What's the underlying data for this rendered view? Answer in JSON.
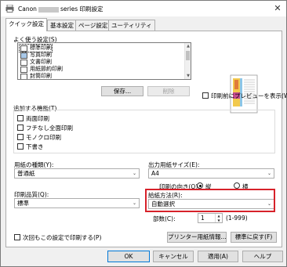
{
  "window": {
    "title_prefix": "Canon",
    "title_suffix": "series 印刷設定",
    "close_glyph": "✕"
  },
  "tabs": [
    {
      "label": "クイック設定",
      "active": true
    },
    {
      "label": "基本設定",
      "active": false
    },
    {
      "label": "ページ設定",
      "active": false
    },
    {
      "label": "ユーティリティ",
      "active": false
    }
  ],
  "favorites": {
    "label": "よく使う設定(S)",
    "items": [
      "標準印刷",
      "写真印刷",
      "文書印刷",
      "用紙節約印刷",
      "封筒印刷"
    ],
    "save_button": "保存...",
    "delete_button": "削除"
  },
  "preview": {
    "checkbox_label": "印刷前にプレビューを表示(W)"
  },
  "additional": {
    "label": "追加する機能(T)",
    "items": [
      "両面印刷",
      "フチなし全面印刷",
      "モノクロ印刷",
      "下書き"
    ]
  },
  "media_type": {
    "label": "用紙の種類(Y):",
    "value": "普通紙"
  },
  "paper_size": {
    "label": "出力用紙サイズ(E):",
    "value": "A4"
  },
  "orientation": {
    "label": "印刷の向き(O):",
    "portrait": "縦",
    "landscape": "横"
  },
  "quality": {
    "label": "印刷品質(Q):",
    "value": "標準"
  },
  "paper_source": {
    "label": "給紙方法(R):",
    "value": "自動選択"
  },
  "copies": {
    "label": "部数(C):",
    "value": "1",
    "range": "(1-999)"
  },
  "always_print": {
    "label": "次回もこの設定で印刷する(P)"
  },
  "printer_media_info_button": "プリンター用紙情報...",
  "defaults_button": "標準に戻す(F)",
  "footer": {
    "ok": "OK",
    "cancel": "キャンセル",
    "apply": "適用(A)",
    "help": "ヘルプ"
  },
  "colors": {
    "highlight": "#d7222a",
    "accent": "#0078d7"
  }
}
